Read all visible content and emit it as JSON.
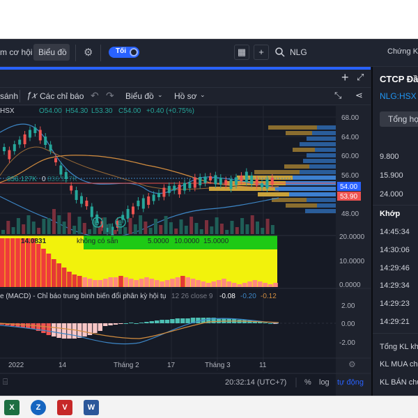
{
  "toolbar": {
    "nav_partial": "m cơ hội",
    "chart_button": "Biểu đồ",
    "theme_toggle": "Tối",
    "search_value": "NLG",
    "right_text": "Chứng K"
  },
  "chart_header": {
    "compare_partial": "sánh",
    "indicators": "Các chỉ báo",
    "chart_type": "Biểu đồ",
    "template": "Hồ sơ",
    "symbol_partial": "HSX",
    "open": "O54.00",
    "high": "H54.30",
    "low": "L53.30",
    "close": "C54.00",
    "change": "+0.40 (+0.75%)",
    "volume_text": "836.127K",
    "volume_zero": "0",
    "volume_text2": "836.127K"
  },
  "indicators": {
    "stoch_value": "14.0831",
    "stoch_na": "không có sẵn",
    "stoch_vals": [
      "5.0000",
      "10.0000",
      "15.0000"
    ],
    "macd_title": "e (MACD) - Chỉ báo trung bình biến đổi phân kỳ hội tụ",
    "macd_params": "12 26 close 9",
    "macd_v1": "-0.08",
    "macd_v2": "-0.20",
    "macd_v3": "-0.12"
  },
  "time_axis": [
    "2022",
    "14",
    "Tháng 2",
    "17",
    "Tháng 3",
    "11"
  ],
  "price_axis": [
    "68.00",
    "64.00",
    "60.00",
    "56.00",
    "52.00",
    "48.00"
  ],
  "price_tags": {
    "blue": "54.00",
    "red": "53.90"
  },
  "stoch_axis": [
    "20.0000",
    "10.0000",
    "0.0000"
  ],
  "macd_axis": [
    "2.00",
    "0.00",
    "-2.00"
  ],
  "footer": {
    "time": "20:32:14 (UTC+7)",
    "percent": "%",
    "log": "log",
    "auto": "tự động"
  },
  "right_panel": {
    "company": "CTCP Đầu",
    "ticker": "NLG:HSX",
    "summary_button": "Tổng hợp",
    "prices": [
      "9.800",
      "15.900",
      "24.000"
    ],
    "match_label": "Khớp",
    "times": [
      "14:45:34",
      "14:30:06",
      "14:29:46",
      "14:29:34",
      "14:29:23",
      "14:29:21"
    ],
    "stat_labels": [
      "Tổng KL khớ",
      "KL MUA chủ",
      "KL BÁN chủ"
    ]
  },
  "colors": {
    "up": "#26a69a",
    "down": "#ef5350",
    "accent": "#2962ff"
  },
  "icons": [
    "gear-icon",
    "grid-icon",
    "plus-icon",
    "search-icon",
    "fx-icon",
    "undo-icon",
    "redo-icon",
    "chevron-down-icon",
    "expand-icon",
    "share-icon",
    "camera-icon"
  ]
}
